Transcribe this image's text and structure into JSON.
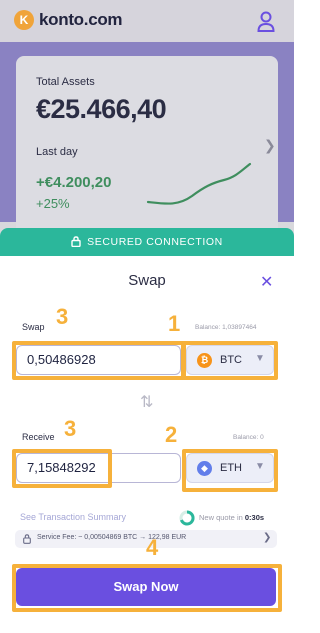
{
  "app": {
    "brand": "konto.com",
    "logo_letter": "K"
  },
  "dashboard": {
    "total_assets_label": "Total Assets",
    "total_assets_value": "€25.466,40",
    "last_day_label": "Last day",
    "last_day_change": "+€4.200,20",
    "last_day_percent": "+25%"
  },
  "secured_banner": "SECURED CONNECTION",
  "modal": {
    "title": "Swap",
    "close_glyph": "✕",
    "swap": {
      "label": "Swap",
      "balance": "Balance: 1,03897464",
      "amount": "0,50486928",
      "coin": "BTC",
      "coin_symbol": "₿",
      "coin_color": "#f7931a"
    },
    "receive": {
      "label": "Receive",
      "balance": "Balance: 0",
      "amount": "7,15848292",
      "coin": "ETH",
      "coin_symbol": "◆",
      "coin_color": "#627eea"
    },
    "swap_direction_glyph": "⇅",
    "summary_link": "See Transaction Summary",
    "quote_prefix": "New quote in ",
    "quote_countdown": "0:30s",
    "fee_text": "Service Fee: ~ 0,00504869 BTC → 122,98 EUR",
    "swap_button": "Swap Now"
  },
  "annotations": [
    "1",
    "2",
    "3",
    "3",
    "4"
  ],
  "colors": {
    "accent": "#6a4fe0",
    "secure": "#2bb79b",
    "highlight": "#f6b13b",
    "positive": "#3f8e5e"
  }
}
